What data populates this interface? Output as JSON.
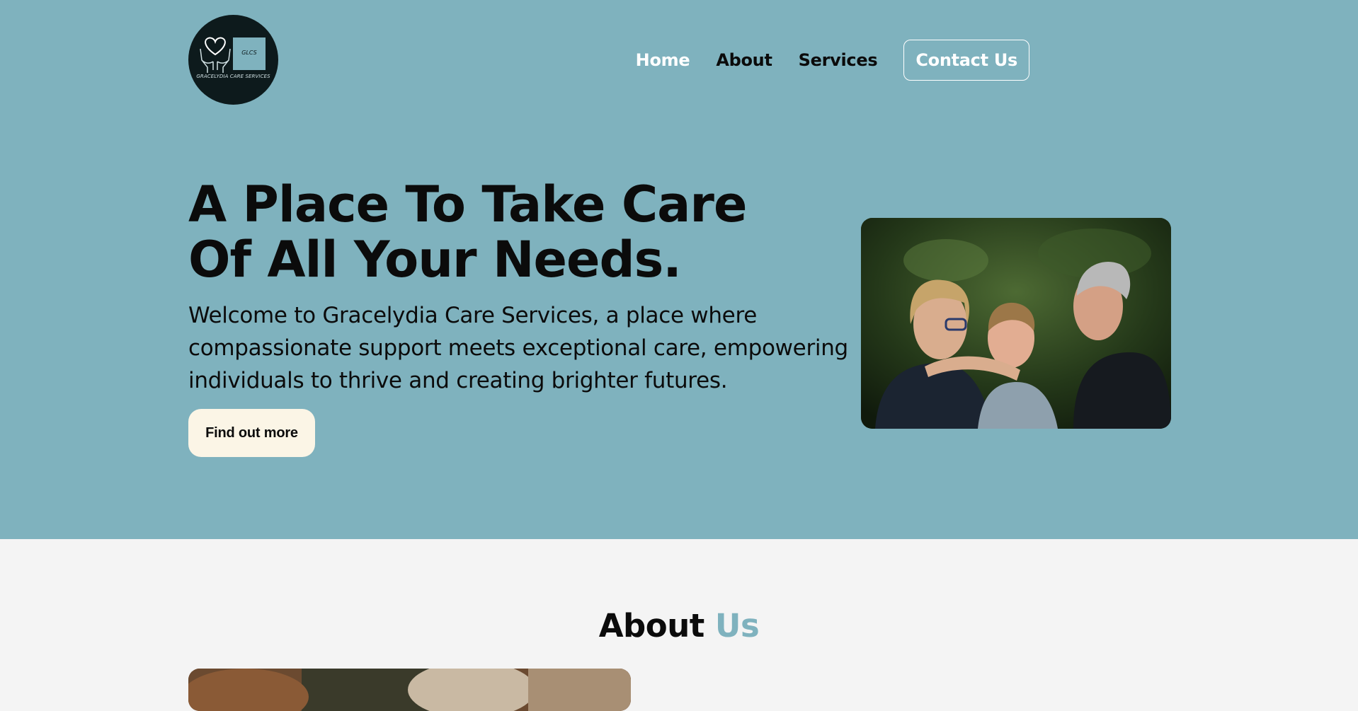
{
  "colors": {
    "hero_bg": "#7fb2be",
    "accent": "#7fb2be",
    "page_bg": "#f4f4f4",
    "cta_bg": "#fbf5e6",
    "text": "#0b0b0b",
    "white": "#ffffff"
  },
  "logo": {
    "abbr": "GLCS",
    "name": "GRACELYDIA CARE SERVICES",
    "icon": "heart-hands-icon"
  },
  "nav": {
    "items": [
      {
        "label": "Home",
        "active": true
      },
      {
        "label": "About",
        "active": false
      },
      {
        "label": "Services",
        "active": false
      }
    ],
    "contact_label": "Contact Us"
  },
  "hero": {
    "title": "A Place To Take Care Of All Your Needs.",
    "text": "Welcome to Gracelydia Care Services, a place where compassionate support meets exceptional care, empowering individuals to thrive and creating brighter futures.",
    "cta_label": "Find out more"
  },
  "about": {
    "title_main": "About",
    "title_accent": "Us"
  }
}
